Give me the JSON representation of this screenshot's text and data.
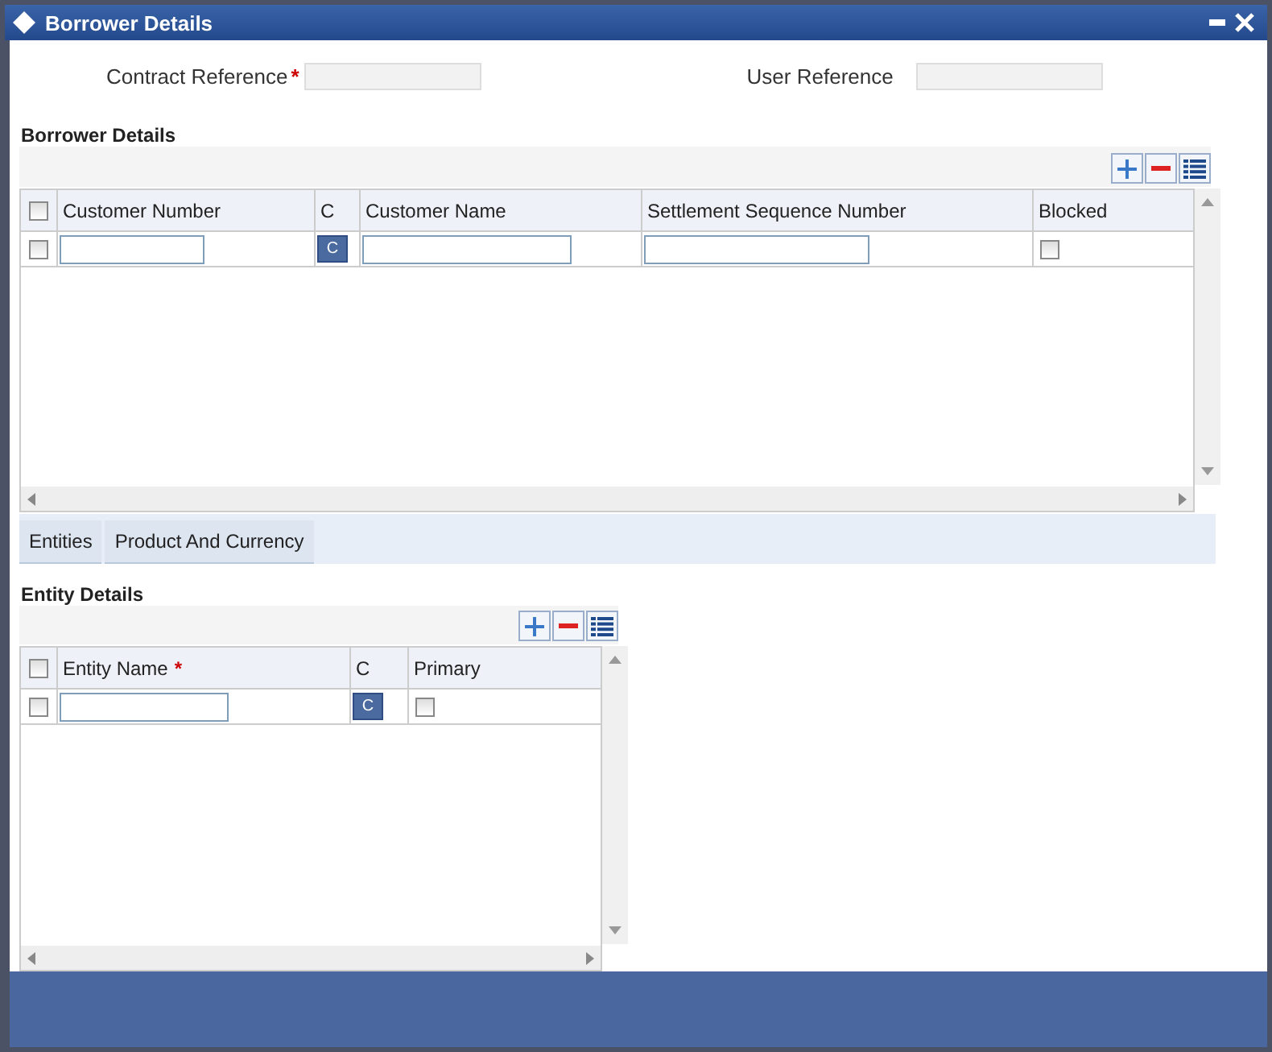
{
  "window": {
    "title": "Borrower Details"
  },
  "fields": [
    {
      "label": "Contract Reference",
      "required_mark": "*"
    },
    {
      "label": "User Reference"
    }
  ],
  "borrower_details": {
    "title": "Borrower Details",
    "header_checked": false,
    "columns": [
      {
        "label": "Customer Number"
      },
      {
        "label": "C"
      },
      {
        "label": "Customer Name"
      },
      {
        "label": "Settlement Sequence Number"
      },
      {
        "label": "Blocked"
      }
    ],
    "rows": [
      {
        "checked": false,
        "cells": [
          {
            "kind": "input"
          },
          {
            "kind": "button",
            "label": "C"
          },
          {
            "kind": "input"
          },
          {
            "kind": "input"
          },
          {
            "kind": "check",
            "checked": false
          }
        ]
      }
    ]
  },
  "tabs": [
    {
      "label": "Entities",
      "selected": false
    },
    {
      "label": "Product And Currency",
      "selected": false
    }
  ],
  "entity_details": {
    "title": "Entity Details",
    "header_checked": false,
    "columns": [
      {
        "label": "Entity Name",
        "required_mark": "*"
      },
      {
        "label": "C"
      },
      {
        "label": "Primary"
      }
    ],
    "rows": [
      {
        "checked": false,
        "cells": [
          {
            "kind": "input"
          },
          {
            "kind": "button",
            "label": "C"
          },
          {
            "kind": "check",
            "checked": false
          }
        ]
      }
    ]
  }
}
